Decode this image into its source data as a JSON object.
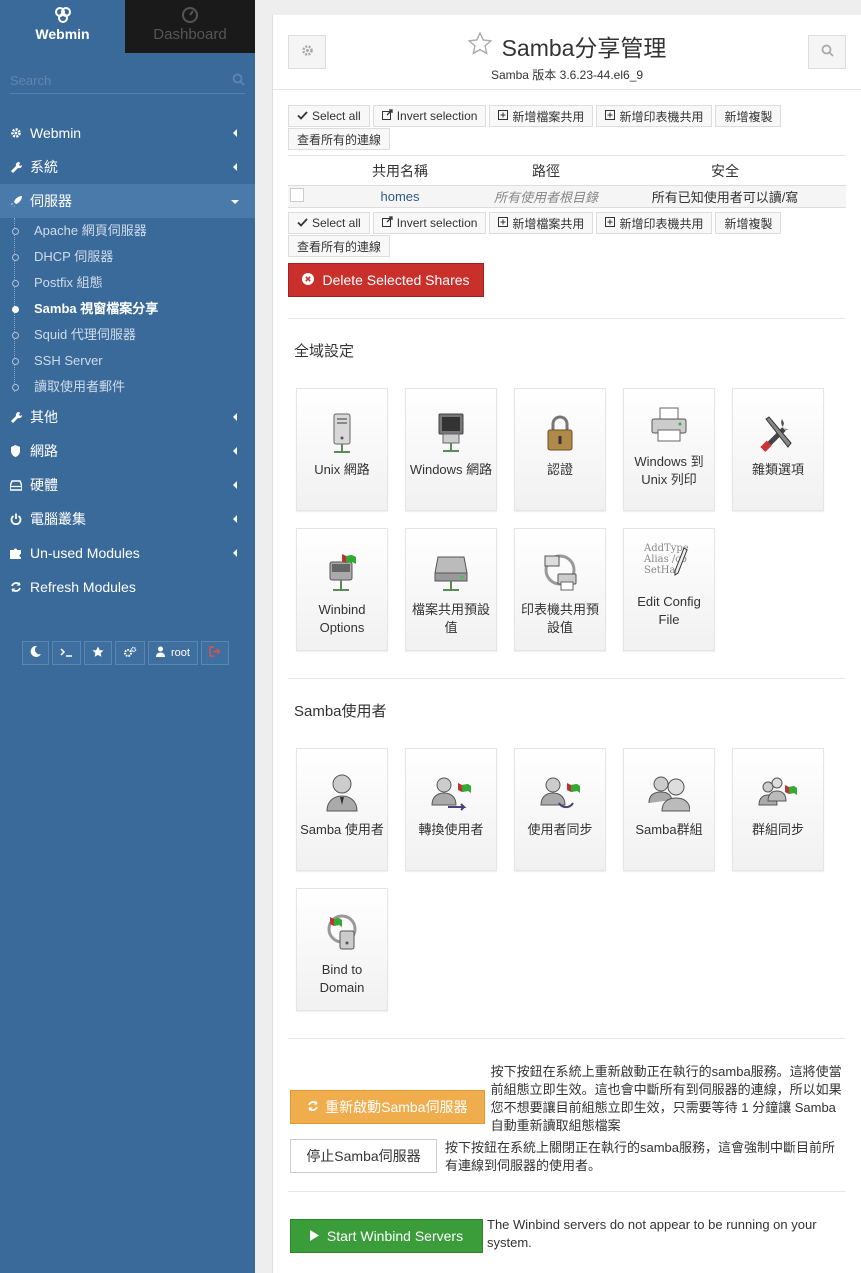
{
  "sidebar": {
    "tab_webmin": "Webmin",
    "tab_dashboard": "Dashboard",
    "search_placeholder": "Search",
    "menu": [
      {
        "label": "Webmin",
        "icon": "gear-icon"
      },
      {
        "label": "系統",
        "icon": "wrench-icon"
      },
      {
        "label": "伺服器",
        "icon": "rocket-icon"
      },
      {
        "label": "其他",
        "icon": "wrench-icon"
      },
      {
        "label": "網路",
        "icon": "shield-icon"
      },
      {
        "label": "硬體",
        "icon": "hdd-icon"
      },
      {
        "label": "電腦叢集",
        "icon": "power-icon"
      },
      {
        "label": "Un-used Modules",
        "icon": "puzzle-icon"
      },
      {
        "label": "Refresh Modules",
        "icon": "refresh-icon"
      }
    ],
    "submenu": [
      "Apache 網頁伺服器",
      "DHCP 伺服器",
      "Postfix 組態",
      "Samba 視窗檔案分享",
      "Squid 代理伺服器",
      "SSH Server",
      "讀取使用者郵件"
    ],
    "user": "root"
  },
  "header": {
    "title": "Samba分享管理",
    "subtitle": "Samba 版本 3.6.23-44.el6_9"
  },
  "toolbar": {
    "select_all": "Select all",
    "invert": "Invert selection",
    "add_file_share": "新增檔案共用",
    "add_printer_share": "新增印表機共用",
    "add_copy": "新增複製",
    "view_all_connections": "查看所有的連線"
  },
  "table": {
    "headers": [
      "共用名稱",
      "路徑",
      "安全"
    ],
    "rows": [
      {
        "name": "homes",
        "path": "所有使用者根目錄",
        "security": "所有已知使用者可以讀/寫"
      }
    ]
  },
  "delete_button": "Delete Selected Shares",
  "global": {
    "title": "全域設定",
    "tiles": [
      {
        "label": "Unix 網路",
        "icon": "server-icon"
      },
      {
        "label": "Windows 網路",
        "icon": "monitor-icon"
      },
      {
        "label": "認證",
        "icon": "padlock-icon"
      },
      {
        "label": "Windows 到 Unix 列印",
        "icon": "printer-icon"
      },
      {
        "label": "雜類選項",
        "icon": "tools-icon"
      },
      {
        "label": "Winbind Options",
        "icon": "winbind-icon"
      },
      {
        "label": "檔案共用預設值",
        "icon": "drive-icon"
      },
      {
        "label": "印表機共用預設值",
        "icon": "printer-share-icon"
      },
      {
        "label": "Edit Config File",
        "icon": "edit-config-icon",
        "overlay": [
          "AddType",
          "Alias /co",
          "SetHa"
        ]
      }
    ]
  },
  "users": {
    "title": "Samba使用者",
    "tiles": [
      {
        "label": "Samba 使用者",
        "icon": "user-icon"
      },
      {
        "label": "轉換使用者",
        "icon": "user-convert-icon"
      },
      {
        "label": "使用者同步",
        "icon": "user-sync-icon"
      },
      {
        "label": "Samba群組",
        "icon": "group-icon"
      },
      {
        "label": "群組同步",
        "icon": "group-sync-icon"
      },
      {
        "label": "Bind to Domain",
        "icon": "bind-domain-icon"
      }
    ]
  },
  "actions": {
    "restart_label": "重新啟動Samba伺服器",
    "restart_desc": "按下按鈕在系統上重新啟動正在執行的samba服務。這將使當前組態立即生效。這也會中斷所有到伺服器的連線，所以如果您不想要讓目前組態立即生效，只需要等待 1 分鐘讓 Samba 自動重新讀取組態檔案",
    "stop_label": "停止Samba伺服器",
    "stop_desc": "按下按鈕在系統上關閉正在執行的samba服務，這會強制中斷目前所有連線到伺服器的使用者。",
    "winbind_label": "Start Winbind Servers",
    "winbind_desc": "The Winbind servers do not appear to be running on your system."
  },
  "colors": {
    "sidebar": "#3a6a9a",
    "danger": "#c9302c",
    "warning": "#f0ad4e",
    "success": "#3a9d3a"
  }
}
